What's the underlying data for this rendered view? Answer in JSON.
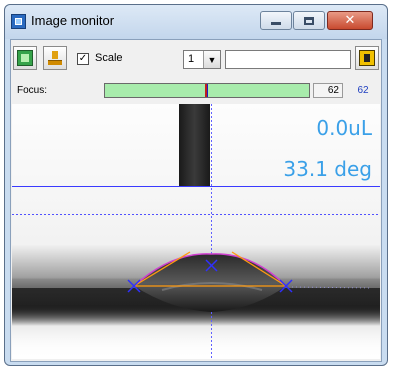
{
  "window": {
    "title": "Image monitor",
    "close_glyph": "✕"
  },
  "toolbar": {
    "scale_label": "Scale",
    "scale_checked_glyph": "✓",
    "select_value": "1",
    "select_arrow": "▼",
    "text_value": ""
  },
  "focus": {
    "label": "Focus:",
    "value_box": "62",
    "value_text": "62",
    "level_fraction": 0.49
  },
  "overlay": {
    "volume": "0.0uL",
    "angle": "33.1 deg"
  },
  "colors": {
    "overlay_text": "#3aa0e8",
    "baseline": "#2a2aff",
    "tangent": "#ff9a10",
    "focus_fill": "#a8ecac"
  },
  "icons": [
    "app-icon",
    "chip-icon",
    "tray-icon",
    "exit-icon",
    "minimize-icon",
    "maximize-icon",
    "close-icon",
    "dropdown-arrow-icon"
  ]
}
